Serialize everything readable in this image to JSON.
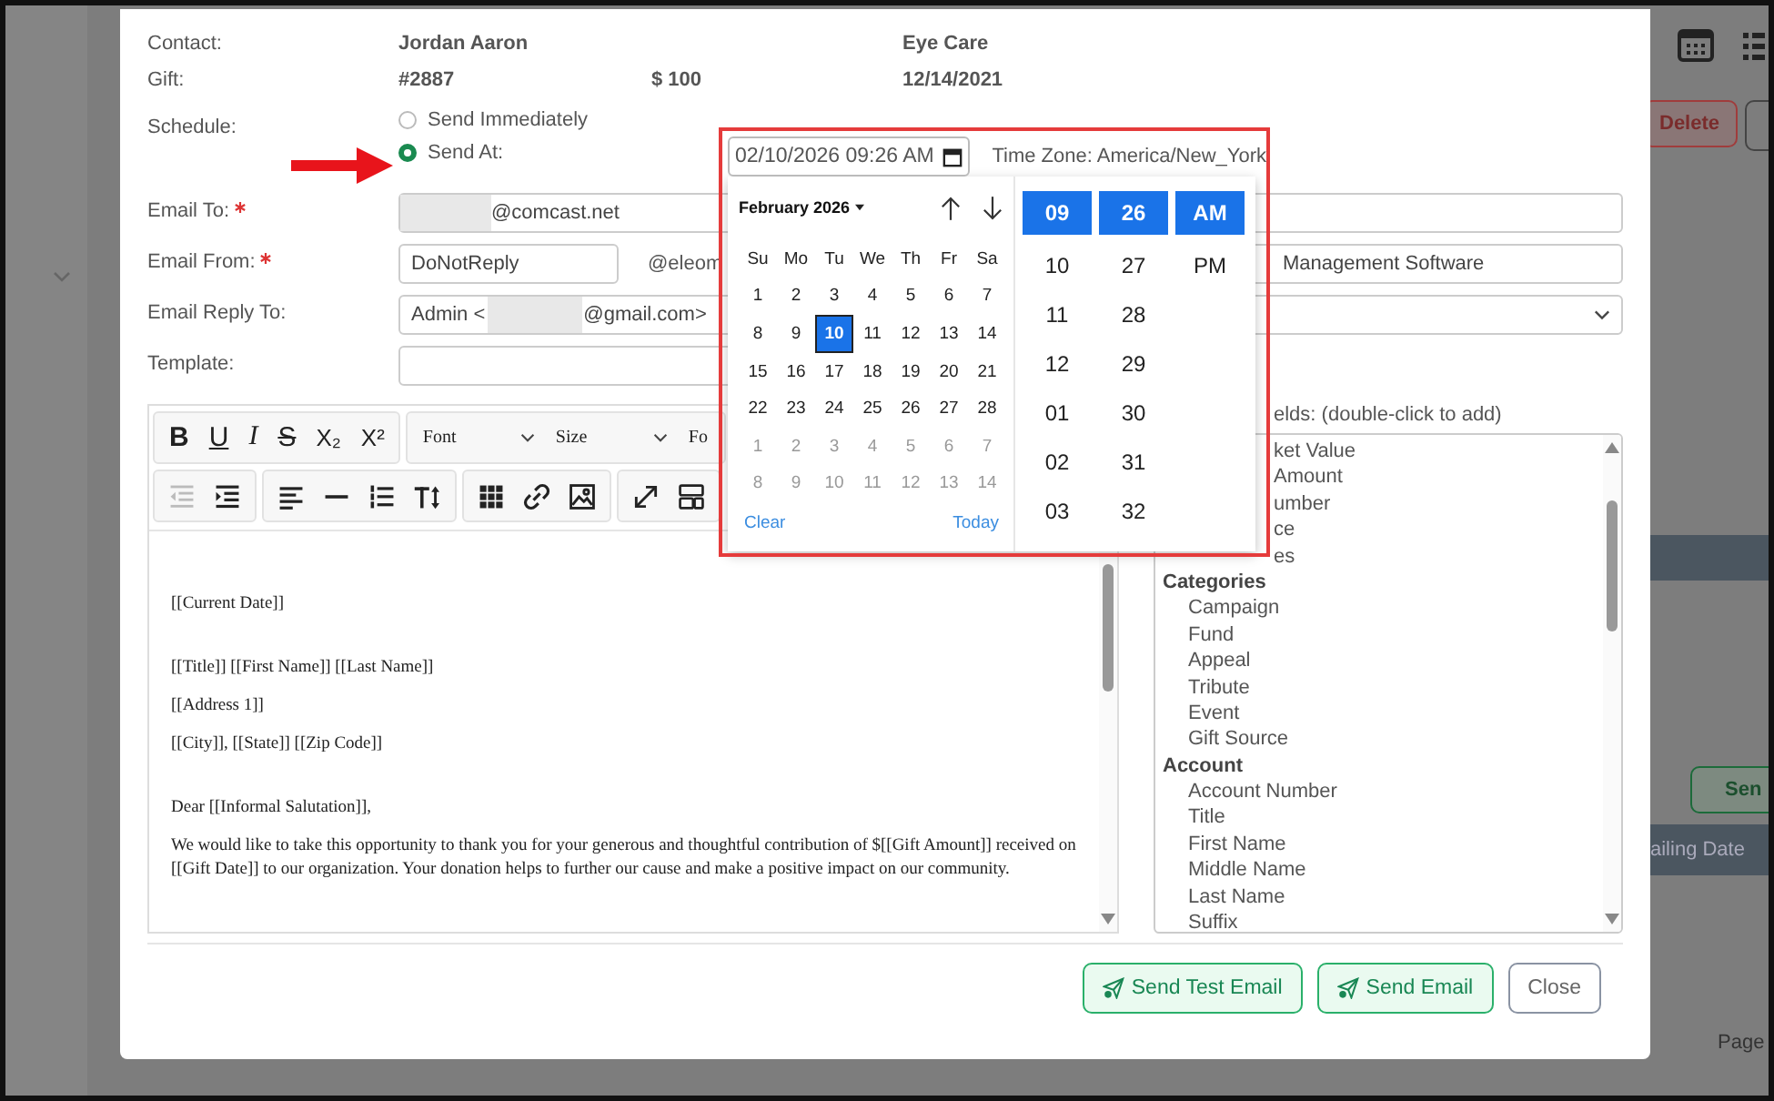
{
  "background": {
    "delete_button": "Delete",
    "send_button": "Sen",
    "column_header": "ailing Date",
    "pager_label": "Page"
  },
  "modal": {
    "info": [
      {
        "label": "Contact:",
        "name": "Jordan Aaron",
        "detail": "Eye Care"
      },
      {
        "label": "Gift:",
        "name": "#2887",
        "amount": "$ 100",
        "detail": "12/14/2021"
      }
    ],
    "schedule": {
      "label": "Schedule:",
      "options": [
        {
          "label": "Send Immediately",
          "selected": false
        },
        {
          "label": "Send At:",
          "selected": true
        }
      ]
    },
    "email_to": {
      "label": "Email To:",
      "required": true,
      "value": "@comcast.net"
    },
    "email_from": {
      "label": "Email From:",
      "required": true,
      "value": "DoNotReply",
      "domain": "@eleom",
      "sender": "Management Software"
    },
    "reply_to": {
      "label": "Email Reply To:",
      "prefix": "Admin <",
      "suffix": "@gmail.com>"
    },
    "template": {
      "label": "Template:"
    },
    "editor": {
      "toolbar": [
        [
          {
            "kind": "bold",
            "glyph": "B"
          },
          {
            "kind": "underline",
            "glyph": "U"
          },
          {
            "kind": "italic",
            "glyph": "I"
          },
          {
            "kind": "strike",
            "glyph": "S"
          },
          {
            "kind": "sub",
            "glyph": "X₂"
          },
          {
            "kind": "sup",
            "glyph": "X²"
          }
        ],
        [
          {
            "kind": "select",
            "glyph": "Font"
          },
          {
            "kind": "select",
            "glyph": "Size"
          },
          {
            "kind": "cut",
            "glyph": "Fo"
          }
        ]
      ],
      "toolbar2": [
        [
          {
            "kind": "outdent"
          },
          {
            "kind": "indent"
          }
        ],
        [
          {
            "kind": "align-left"
          },
          {
            "kind": "rule"
          },
          {
            "kind": "numbered-list"
          },
          {
            "kind": "text-size"
          }
        ],
        [
          {
            "kind": "table"
          },
          {
            "kind": "link"
          },
          {
            "kind": "image"
          }
        ],
        [
          {
            "kind": "expand"
          },
          {
            "kind": "layout"
          }
        ]
      ],
      "body": [
        {
          "kind": "section",
          "text": "[[Current Date]]"
        },
        {
          "kind": "section",
          "text": "[[Title]] [[First Name]] [[Last Name]]"
        },
        {
          "kind": "line",
          "text": "[[Address 1]]"
        },
        {
          "kind": "line",
          "text": "[[City]], [[State]] [[Zip Code]]"
        },
        {
          "kind": "section",
          "text": "Dear [[Informal Salutation]],"
        },
        {
          "kind": "line",
          "text": "We would like to take this opportunity to thank you for your generous and thoughtful contribution of $[[Gift Amount]] received on [[Gift Date]] to our organization.  Your donation helps to further our cause and make a positive impact on our community."
        }
      ]
    },
    "fields": {
      "label": "elds: (double-click to add)",
      "items": [
        {
          "kind": "clipped",
          "label": "ket Value"
        },
        {
          "kind": "clipped",
          "label": "Amount"
        },
        {
          "kind": "clipped",
          "label": "umber"
        },
        {
          "kind": "clipped",
          "label": "ce"
        },
        {
          "kind": "clipped",
          "label": "es"
        },
        {
          "kind": "group",
          "label": "Categories",
          "children": [
            {
              "label": "Campaign"
            },
            {
              "label": "Fund"
            },
            {
              "label": "Appeal"
            },
            {
              "label": "Tribute"
            },
            {
              "label": "Event"
            },
            {
              "label": "Gift Source"
            }
          ]
        },
        {
          "kind": "group",
          "label": "Account",
          "children": [
            {
              "label": "Account Number"
            },
            {
              "label": "Title"
            },
            {
              "label": "First Name"
            },
            {
              "label": "Middle Name"
            },
            {
              "label": "Last Name"
            },
            {
              "label": "Suffix"
            }
          ]
        }
      ]
    },
    "buttons": [
      {
        "label": "Send Test Email",
        "kind": "primary"
      },
      {
        "label": "Send Email",
        "kind": "primary"
      },
      {
        "label": "Close",
        "kind": "secondary"
      }
    ]
  },
  "picker": {
    "value": "02/10/2026 09:26 AM",
    "timezone": "Time Zone: America/New_York",
    "month": "February 2026",
    "weekdays": [
      "Su",
      "Mo",
      "Tu",
      "We",
      "Th",
      "Fr",
      "Sa"
    ],
    "days": [
      {
        "label": "1",
        "muted": false,
        "selected": false
      },
      {
        "label": "2",
        "muted": false,
        "selected": false
      },
      {
        "label": "3",
        "muted": false,
        "selected": false
      },
      {
        "label": "4",
        "muted": false,
        "selected": false
      },
      {
        "label": "5",
        "muted": false,
        "selected": false
      },
      {
        "label": "6",
        "muted": false,
        "selected": false
      },
      {
        "label": "7",
        "muted": false,
        "selected": false
      },
      {
        "label": "8",
        "muted": false,
        "selected": false
      },
      {
        "label": "9",
        "muted": false,
        "selected": false
      },
      {
        "label": "10",
        "muted": false,
        "selected": true
      },
      {
        "label": "11",
        "muted": false,
        "selected": false
      },
      {
        "label": "12",
        "muted": false,
        "selected": false
      },
      {
        "label": "13",
        "muted": false,
        "selected": false
      },
      {
        "label": "14",
        "muted": false,
        "selected": false
      },
      {
        "label": "15",
        "muted": false,
        "selected": false
      },
      {
        "label": "16",
        "muted": false,
        "selected": false
      },
      {
        "label": "17",
        "muted": false,
        "selected": false
      },
      {
        "label": "18",
        "muted": false,
        "selected": false
      },
      {
        "label": "19",
        "muted": false,
        "selected": false
      },
      {
        "label": "20",
        "muted": false,
        "selected": false
      },
      {
        "label": "21",
        "muted": false,
        "selected": false
      },
      {
        "label": "22",
        "muted": false,
        "selected": false
      },
      {
        "label": "23",
        "muted": false,
        "selected": false
      },
      {
        "label": "24",
        "muted": false,
        "selected": false
      },
      {
        "label": "25",
        "muted": false,
        "selected": false
      },
      {
        "label": "26",
        "muted": false,
        "selected": false
      },
      {
        "label": "27",
        "muted": false,
        "selected": false
      },
      {
        "label": "28",
        "muted": false,
        "selected": false
      },
      {
        "label": "1",
        "muted": true,
        "selected": false
      },
      {
        "label": "2",
        "muted": true,
        "selected": false
      },
      {
        "label": "3",
        "muted": true,
        "selected": false
      },
      {
        "label": "4",
        "muted": true,
        "selected": false
      },
      {
        "label": "5",
        "muted": true,
        "selected": false
      },
      {
        "label": "6",
        "muted": true,
        "selected": false
      },
      {
        "label": "7",
        "muted": true,
        "selected": false
      },
      {
        "label": "8",
        "muted": true,
        "selected": false
      },
      {
        "label": "9",
        "muted": true,
        "selected": false
      },
      {
        "label": "10",
        "muted": true,
        "selected": false
      },
      {
        "label": "11",
        "muted": true,
        "selected": false
      },
      {
        "label": "12",
        "muted": true,
        "selected": false
      },
      {
        "label": "13",
        "muted": true,
        "selected": false
      },
      {
        "label": "14",
        "muted": true,
        "selected": false
      }
    ],
    "clear": "Clear",
    "today": "Today",
    "hours": [
      {
        "label": "09",
        "selected": true
      },
      {
        "label": "10",
        "selected": false
      },
      {
        "label": "11",
        "selected": false
      },
      {
        "label": "12",
        "selected": false
      },
      {
        "label": "01",
        "selected": false
      },
      {
        "label": "02",
        "selected": false
      },
      {
        "label": "03",
        "selected": false
      }
    ],
    "minutes": [
      {
        "label": "26",
        "selected": true
      },
      {
        "label": "27",
        "selected": false
      },
      {
        "label": "28",
        "selected": false
      },
      {
        "label": "29",
        "selected": false
      },
      {
        "label": "30",
        "selected": false
      },
      {
        "label": "31",
        "selected": false
      },
      {
        "label": "32",
        "selected": false
      }
    ],
    "periods": [
      {
        "label": "AM",
        "selected": true
      },
      {
        "label": "PM",
        "selected": false
      }
    ]
  }
}
